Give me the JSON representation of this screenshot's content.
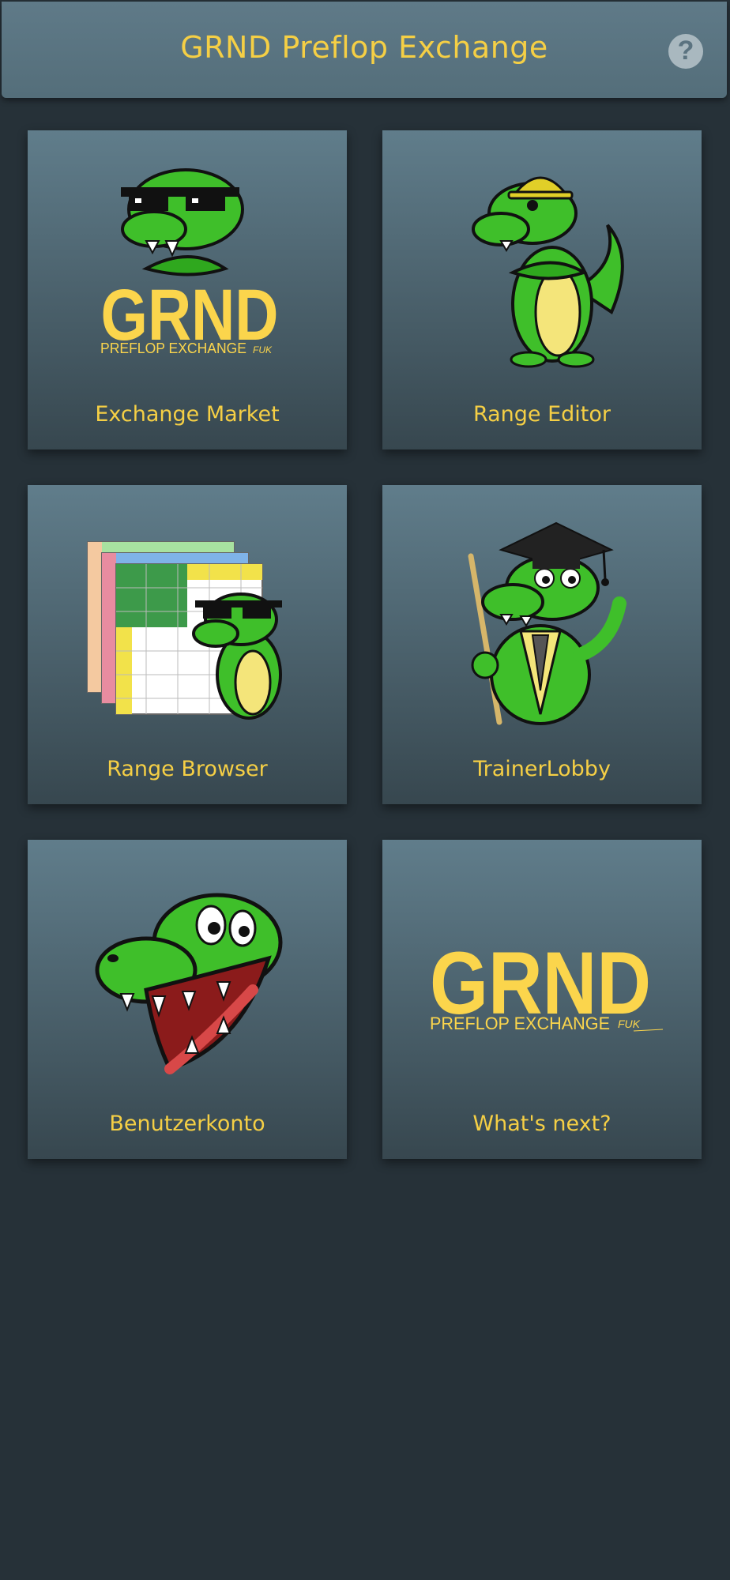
{
  "app": {
    "title": "GRND Preflop Exchange",
    "help_icon": "question-mark-icon"
  },
  "tiles": [
    {
      "label": "Exchange Market",
      "icon": "crocodile-sunglasses-logo"
    },
    {
      "label": "Range Editor",
      "icon": "crocodile-hardhat"
    },
    {
      "label": "Range Browser",
      "icon": "range-charts-crocodile"
    },
    {
      "label": "TrainerLobby",
      "icon": "crocodile-graduate"
    },
    {
      "label": "Benutzerkonto",
      "icon": "crocodile-head"
    },
    {
      "label": "What's next?",
      "icon": "grnd-logo"
    }
  ],
  "logo": {
    "word": "GRND",
    "subtitle": "PREFLOP EXCHANGE",
    "signature": "FUK"
  },
  "colors": {
    "background": "#263138",
    "header": "#546e7a",
    "accent": "#f5cf45",
    "croc_green": "#3fbf2a"
  }
}
